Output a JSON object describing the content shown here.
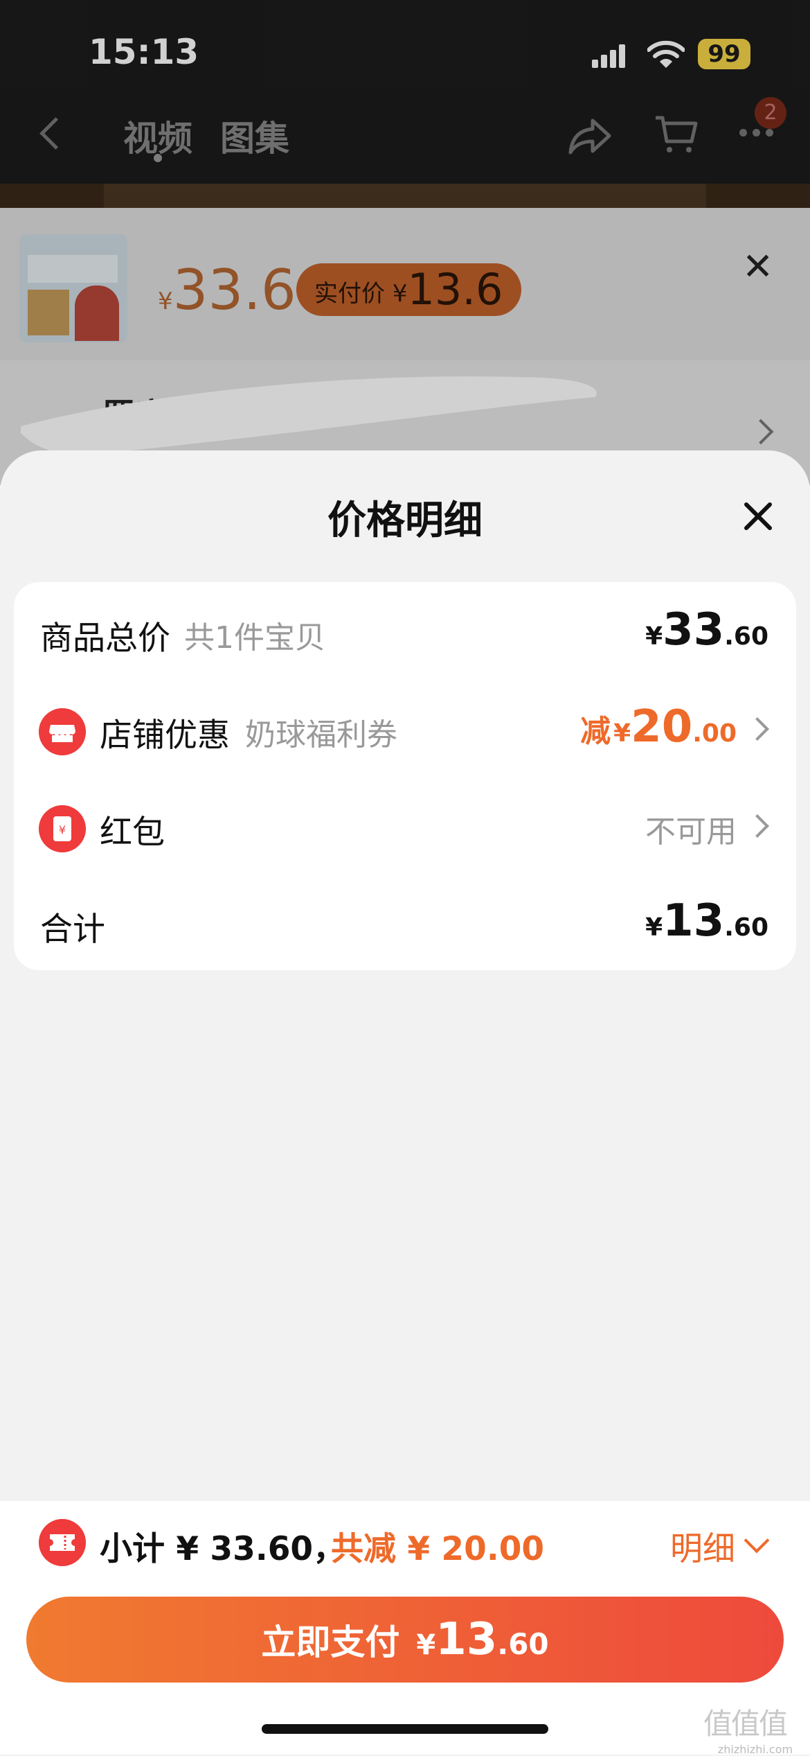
{
  "status_bar": {
    "time": "15:13",
    "battery": "99"
  },
  "nav": {
    "tabs": [
      "视频",
      "图集"
    ],
    "cart_badge": "2"
  },
  "background_product": {
    "currency": "¥",
    "price": "33.6",
    "badge_label": "实付价",
    "badge_currency": "¥",
    "badge_price": "13.6"
  },
  "background_shop": {
    "name_partial": "罗宾"
  },
  "sheet": {
    "title": "价格明细",
    "rows": [
      {
        "label": "商品总价",
        "sub": "共1件宝贝",
        "currency": "¥",
        "int": "33",
        "dec": ".60"
      },
      {
        "label": "店铺优惠",
        "sub": "奶球福利券",
        "prefix": "减",
        "currency": "¥",
        "int": "20",
        "dec": ".00"
      },
      {
        "label": "红包",
        "status": "不可用"
      },
      {
        "label": "合计",
        "currency": "¥",
        "int": "13",
        "dec": ".60"
      }
    ]
  },
  "bottom": {
    "subtotal": "小计 ¥ 33.60，",
    "discount": "共减 ¥ 20.00",
    "detail_link": "明细",
    "pay_label": "立即支付",
    "pay_currency": "¥",
    "pay_int": "13",
    "pay_dec": ".60"
  },
  "watermark": {
    "glyphs": "值值值",
    "site": "zhizhizhi.com"
  },
  "colors": {
    "accent_orange": "#ee6a2a",
    "icon_red": "#ef3b3b",
    "badge_yellow": "#f6d54a"
  }
}
